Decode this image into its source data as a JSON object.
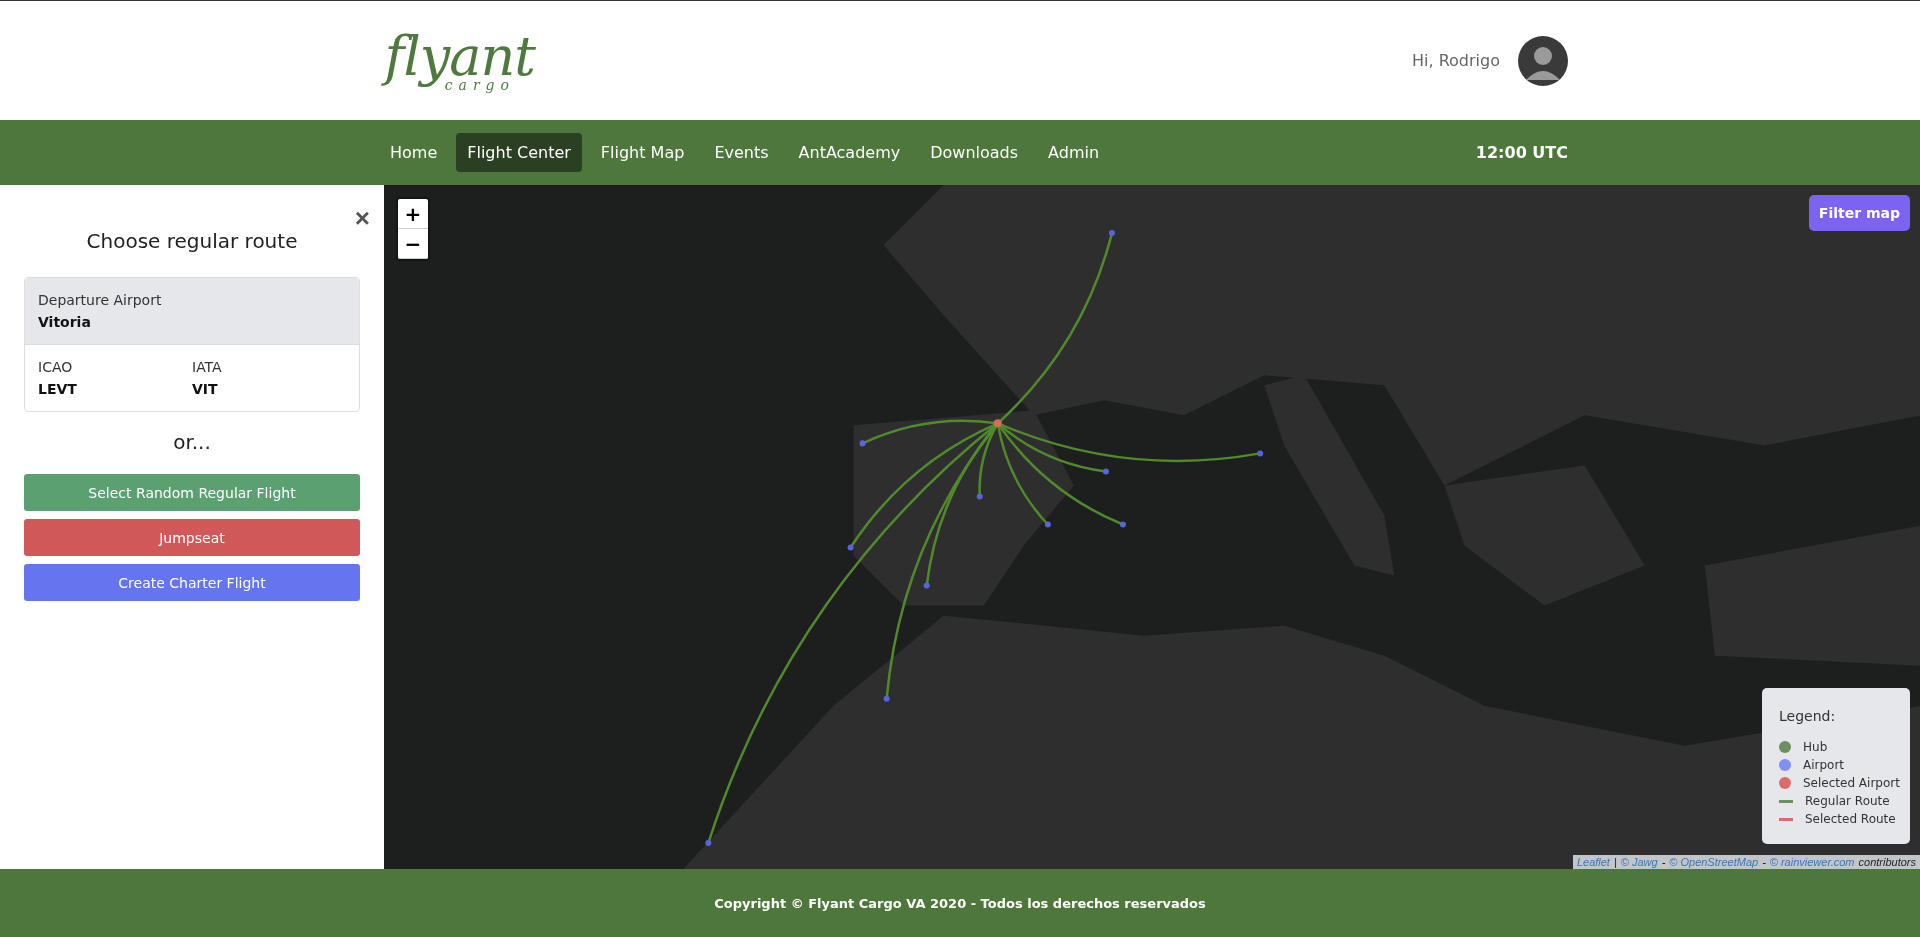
{
  "header": {
    "logo": {
      "main": "flyant",
      "sub": "cargo"
    },
    "greeting": "Hi, Rodrigo"
  },
  "nav": {
    "items": [
      {
        "label": "Home",
        "selected": false
      },
      {
        "label": "Flight Center",
        "selected": true
      },
      {
        "label": "Flight Map",
        "selected": false
      },
      {
        "label": "Events",
        "selected": false
      },
      {
        "label": "AntAcademy",
        "selected": false
      },
      {
        "label": "Downloads",
        "selected": false
      },
      {
        "label": "Admin",
        "selected": false
      }
    ],
    "time": "12:00 UTC"
  },
  "panel": {
    "close": "×",
    "title": "Choose regular route",
    "departure": {
      "label": "Departure Airport",
      "value": "Vitoria"
    },
    "codes": [
      {
        "label": "ICAO",
        "value": "LEVT"
      },
      {
        "label": "IATA",
        "value": "VIT"
      }
    ],
    "or": "or...",
    "buttons": [
      {
        "label": "Select Random Regular Flight",
        "color": "#5aa070"
      },
      {
        "label": "Jumpseat",
        "color": "#d05858"
      },
      {
        "label": "Create Charter Flight",
        "color": "#6574ef"
      }
    ]
  },
  "map": {
    "kind": "picture",
    "zoom": [
      "+",
      "−"
    ],
    "filter": "Filter map",
    "legend": {
      "title": "Legend:",
      "items": [
        {
          "kind": "dot",
          "label": "Hub",
          "color": "#6b8f5e"
        },
        {
          "kind": "dot",
          "label": "Airport",
          "color": "#7f8ff5"
        },
        {
          "kind": "dot",
          "label": "Selected Airport",
          "color": "#de6b6b"
        },
        {
          "kind": "line",
          "label": "Regular Route",
          "color": "#6b8f5e"
        },
        {
          "kind": "line",
          "label": "Selected Route",
          "color": "#de6b6b"
        }
      ]
    },
    "attribution": [
      {
        "text": "Leaflet",
        "link": true
      },
      {
        "text": "|",
        "link": false
      },
      {
        "text": "© Jawg",
        "link": true
      },
      {
        "text": "-",
        "link": false
      },
      {
        "text": "© OpenStreetMap",
        "link": true
      },
      {
        "text": "-",
        "link": false
      },
      {
        "text": "© rainviewer.com",
        "link": true
      },
      {
        "text": "contributors",
        "link": false
      }
    ]
  },
  "footer": "Copyright © Flyant Cargo VA 2020 - Todos los derechos reservados"
}
